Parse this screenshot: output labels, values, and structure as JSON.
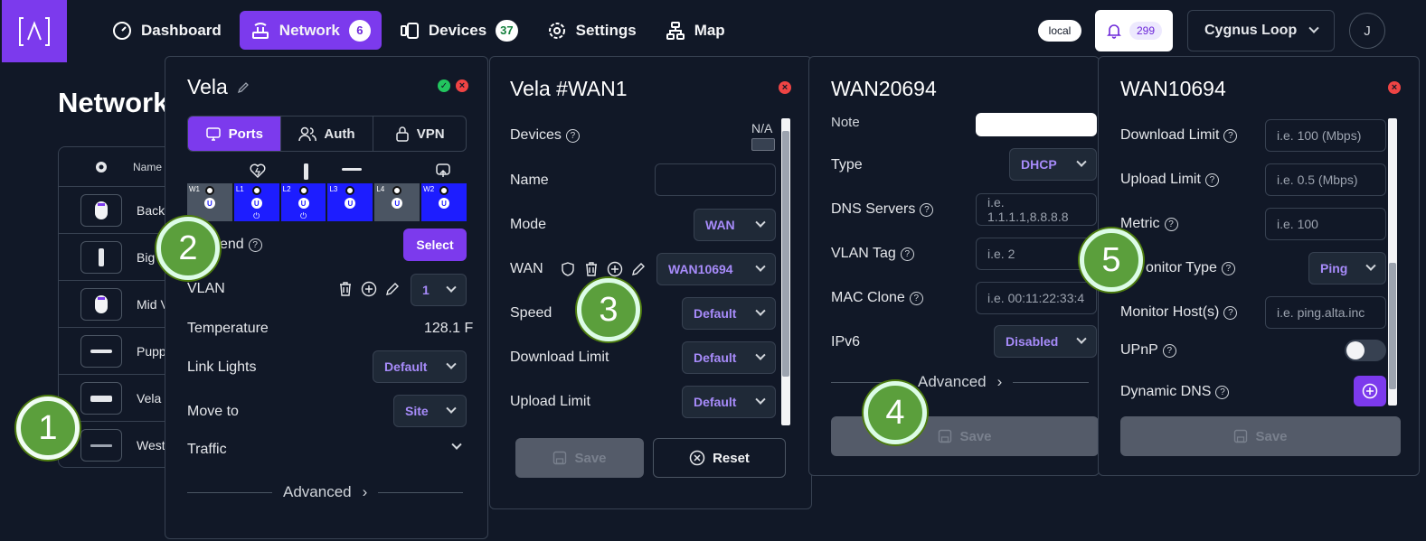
{
  "nav": {
    "logo_text": "[^]",
    "items": [
      {
        "label": "Dashboard",
        "badge": ""
      },
      {
        "label": "Network",
        "badge": "6"
      },
      {
        "label": "Devices",
        "badge": "37"
      },
      {
        "label": "Settings",
        "badge": ""
      },
      {
        "label": "Map",
        "badge": ""
      }
    ],
    "local_label": "local",
    "notifications_count": "299",
    "site_name": "Cygnus Loop",
    "avatar_initial": "J"
  },
  "page": {
    "title": "Network"
  },
  "table": {
    "header_name": "Name",
    "rows": [
      "Back",
      "Big V",
      "Mid V",
      "Pupp",
      "Vela",
      "Weste"
    ]
  },
  "panel_device": {
    "title": "Vela",
    "tabs": [
      "Ports",
      "Auth",
      "VPN"
    ],
    "ports": [
      {
        "label": "W1",
        "mode": "U",
        "power": ""
      },
      {
        "label": "L1",
        "mode": "U",
        "power": "⏻"
      },
      {
        "label": "L2",
        "mode": "U",
        "power": "⏻"
      },
      {
        "label": "L3",
        "mode": "U",
        "power": ""
      },
      {
        "label": "L4",
        "mode": "U",
        "power": ""
      },
      {
        "label": "W2",
        "mode": "U",
        "power": ""
      }
    ],
    "legend_label": "end",
    "select_button": "Select",
    "vlan_label": "VLAN",
    "vlan_value": "1",
    "temperature_label": "Temperature",
    "temperature_value": "128.1 F",
    "link_lights_label": "Link Lights",
    "link_lights_value": "Default",
    "move_to_label": "Move to",
    "move_to_value": "Site",
    "traffic_label": "Traffic",
    "advanced_label": "Advanced"
  },
  "panel_wan": {
    "title": "Vela #WAN1",
    "devices_label": "Devices",
    "devices_value": "N/A",
    "name_label": "Name",
    "name_value": "",
    "mode_label": "Mode",
    "mode_value": "WAN",
    "wan_label": "WAN",
    "wan_value": "WAN10694",
    "speed_label": "Speed",
    "speed_value": "Default",
    "download_label": "Download Limit",
    "download_value": "Default",
    "upload_label": "Upload Limit",
    "upload_value": "Default",
    "save_label": "Save",
    "reset_label": "Reset"
  },
  "panel_wan2": {
    "title": "WAN20694",
    "note_label": "Note",
    "type_label": "Type",
    "type_value": "DHCP",
    "dns_label": "DNS Servers",
    "dns_placeholder": "i.e. 1.1.1.1,8.8.8.8",
    "vlan_tag_label": "VLAN Tag",
    "vlan_tag_placeholder": "i.e. 2",
    "mac_label": "MAC Clone",
    "mac_placeholder": "i.e. 00:11:22:33:4",
    "ipv6_label": "IPv6",
    "ipv6_value": "Disabled",
    "advanced_label": "Advanced",
    "save_label": "Save"
  },
  "panel_wan3": {
    "title": "WAN10694",
    "download_label": "Download Limit",
    "download_placeholder": "i.e. 100 (Mbps)",
    "upload_label": "Upload Limit",
    "upload_placeholder": "i.e. 0.5 (Mbps)",
    "metric_label": "Metric",
    "metric_placeholder": "i.e. 100",
    "monitor_type_label": "onitor Type",
    "monitor_type_value": "Ping",
    "monitor_host_label": "Monitor Host(s)",
    "monitor_host_placeholder": "i.e. ping.alta.inc",
    "upnp_label": "UPnP",
    "ddns_label": "Dynamic DNS",
    "save_label": "Save"
  },
  "markers": [
    "1",
    "2",
    "3",
    "4",
    "5"
  ],
  "colors": {
    "accent": "#7c3aed",
    "background": "#111827",
    "port_active": "#1d1dff",
    "marker_green": "#5b9f3c"
  }
}
